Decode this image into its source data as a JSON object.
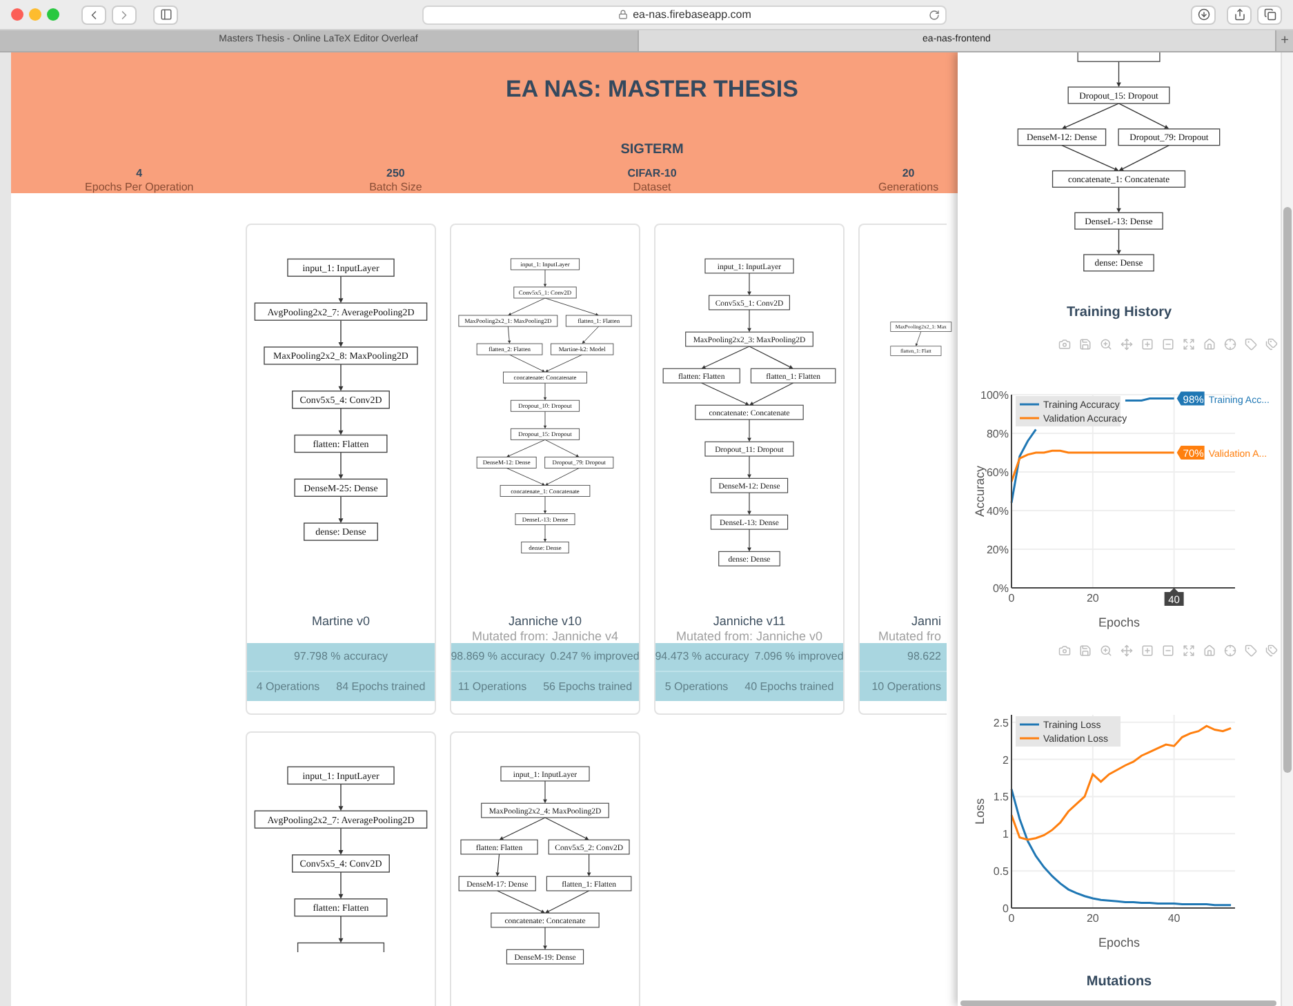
{
  "browser": {
    "url": "ea-nas.firebaseapp.com",
    "tabs": [
      {
        "label": "Masters Thesis - Online LaTeX Editor Overleaf",
        "selected": false
      },
      {
        "label": "ea-nas-frontend",
        "selected": true
      }
    ],
    "new_tab": "+"
  },
  "header": {
    "title": "EA NAS: MASTER THESIS",
    "status": "SIGTERM",
    "stats": [
      {
        "value": "4",
        "label": "Epochs Per Operation"
      },
      {
        "value": "250",
        "label": "Batch Size"
      },
      {
        "value": "CIFAR-10",
        "label": "Dataset"
      },
      {
        "value": "20",
        "label": "Generations"
      }
    ]
  },
  "card_rows": [
    [
      {
        "kind": "full",
        "graph": {
          "cut_bottom": false,
          "rows": [
            [
              {
                "label": "input_1: InputLayer"
              }
            ],
            [
              {
                "label": "AvgPooling2x2_7: AveragePooling2D"
              }
            ],
            [
              {
                "label": "MaxPooling2x2_8: MaxPooling2D"
              }
            ],
            [
              {
                "label": "Conv5x5_4: Conv2D"
              }
            ],
            [
              {
                "label": "flatten: Flatten"
              }
            ],
            [
              {
                "label": "DenseM-25: Dense"
              }
            ],
            [
              {
                "label": "dense: Dense"
              }
            ]
          ]
        },
        "name": "Martine v0",
        "accuracy": "97.798 % accuracy",
        "operations": "4 Operations",
        "epochs": "84 Epochs trained"
      },
      {
        "kind": "full",
        "graph": {
          "cut_bottom": false,
          "rows": [
            [
              {
                "label": "input_1: InputLayer"
              }
            ],
            [
              {
                "label": "Conv5x5_1: Conv2D"
              }
            ],
            [
              {
                "label": "MaxPooling2x2_1: MaxPooling2D"
              },
              {
                "label": "flatten_1: Flatten"
              }
            ],
            [
              {
                "label": "flatten_2: Flatten",
                "join": false
              },
              {
                "label": "Martine-k2: Model",
                "join": false
              }
            ],
            [
              {
                "label": "concatenate: Concatenate",
                "join": true
              }
            ],
            [
              {
                "label": "Dropout_10: Dropout"
              }
            ],
            [
              {
                "label": "Dropout_15: Dropout"
              }
            ],
            [
              {
                "label": "DenseM-12: Dense"
              },
              {
                "label": "Dropout_79: Dropout"
              }
            ],
            [
              {
                "label": "concatenate_1: Concatenate",
                "join": true
              }
            ],
            [
              {
                "label": "DenseL-13: Dense"
              }
            ],
            [
              {
                "label": "dense: Dense"
              }
            ]
          ]
        },
        "name": "Janniche v10",
        "mutated": "Mutated from: Janniche v4",
        "accuracy": "98.869 % accuracy",
        "improvement": "0.247 % improved",
        "operations": "11 Operations",
        "epochs": "56 Epochs trained"
      },
      {
        "kind": "full",
        "graph": {
          "cut_bottom": false,
          "rows": [
            [
              {
                "label": "input_1: InputLayer"
              }
            ],
            [
              {
                "label": "Conv5x5_1: Conv2D"
              }
            ],
            [
              {
                "label": "MaxPooling2x2_3: MaxPooling2D"
              }
            ],
            [
              {
                "label": "flatten: Flatten"
              },
              {
                "label": "flatten_1: Flatten"
              }
            ],
            [
              {
                "label": "concatenate: Concatenate",
                "join": true
              }
            ],
            [
              {
                "label": "Dropout_11: Dropout"
              }
            ],
            [
              {
                "label": "DenseM-12: Dense"
              }
            ],
            [
              {
                "label": "DenseL-13: Dense"
              }
            ],
            [
              {
                "label": "dense: Dense"
              }
            ]
          ]
        },
        "name": "Janniche v11",
        "mutated": "Mutated from: Janniche v0",
        "accuracy": "94.473 % accuracy",
        "improvement": "7.096 % improved",
        "operations": "5 Operations",
        "epochs": "40 Epochs trained"
      },
      {
        "kind": "partial",
        "graph": {
          "cut_bottom": false,
          "rows": [
            [
              {
                "label": "MaxPooling2x2_1: Max"
              }
            ],
            [
              {
                "label": "flatten_1: Flatt"
              }
            ]
          ]
        },
        "name": "Janni",
        "mutated": "Mutated fro",
        "accuracy": "98.622",
        "operations": "10 Operations"
      }
    ],
    [
      {
        "kind": "full",
        "graph": {
          "cut_bottom": true,
          "rows": [
            [
              {
                "label": "input_1: InputLayer"
              }
            ],
            [
              {
                "label": "AvgPooling2x2_7: AveragePooling2D"
              }
            ],
            [
              {
                "label": "Conv5x5_4: Conv2D"
              }
            ],
            [
              {
                "label": "flatten: Flatten"
              }
            ]
          ]
        }
      },
      {
        "kind": "full",
        "graph": {
          "cut_bottom": false,
          "rows": [
            [
              {
                "label": "input_1: InputLayer"
              }
            ],
            [
              {
                "label": "MaxPooling2x2_4: MaxPooling2D"
              }
            ],
            [
              {
                "label": "flatten: Flatten"
              },
              {
                "label": "Conv5x5_2: Conv2D"
              }
            ],
            [
              {
                "label": "DenseM-17: Dense",
                "join": false
              },
              {
                "label": "flatten_1: Flatten",
                "join": false
              }
            ],
            [
              {
                "label": "concatenate: Concatenate",
                "join": true
              }
            ],
            [
              {
                "label": "DenseM-19: Dense"
              }
            ]
          ]
        }
      }
    ]
  ],
  "panel": {
    "graph": {
      "cut_top": true,
      "rows": [
        [
          {
            "label": "Dropout_15: Dropout"
          }
        ],
        [
          {
            "label": "DenseM-12: Dense"
          },
          {
            "label": "Dropout_79: Dropout"
          }
        ],
        [
          {
            "label": "concatenate_1: Concatenate",
            "join": true
          }
        ],
        [
          {
            "label": "DenseL-13: Dense"
          }
        ],
        [
          {
            "label": "dense: Dense"
          }
        ]
      ]
    },
    "history_title": "Training History",
    "charts": [
      {
        "chart_data": {
          "type": "line",
          "xlabel": "Epochs",
          "ylabel": "Accuracy",
          "grid": true,
          "legend": "upper left",
          "x": [
            0,
            2,
            4,
            6,
            8,
            10,
            12,
            14,
            16,
            18,
            20,
            22,
            24,
            26,
            28,
            30,
            32,
            34,
            36,
            38,
            40
          ],
          "series": [
            {
              "name": "Training Accuracy",
              "color": "#1f77b4",
              "values": [
                44,
                68,
                76,
                82,
                null,
                null,
                null,
                null,
                null,
                null,
                null,
                null,
                null,
                null,
                97,
                97,
                97,
                98,
                98,
                98,
                98
              ]
            },
            {
              "name": "Validation Accuracy",
              "color": "#ff7f0e",
              "values": [
                55,
                67,
                69,
                70,
                70,
                71,
                71,
                70,
                70,
                70,
                70,
                70,
                70,
                70,
                70,
                70,
                70,
                70,
                70,
                70,
                70
              ]
            }
          ],
          "xlim": [
            0,
            55
          ],
          "ylim": [
            0,
            100
          ],
          "xticks": [
            0,
            20,
            40
          ],
          "yticks": [
            {
              "value": 0,
              "label": "0%"
            },
            {
              "value": 20,
              "label": "20%"
            },
            {
              "value": 40,
              "label": "40%"
            },
            {
              "value": 60,
              "label": "60%"
            },
            {
              "value": 80,
              "label": "80%"
            },
            {
              "value": 100,
              "label": "100%"
            }
          ],
          "annotations": [
            {
              "x": 40,
              "y": 98,
              "text": "98%"
            },
            "Training Acc...",
            {
              "x": 40,
              "y": 70,
              "text": "70%"
            },
            "Validation A...",
            "40"
          ]
        }
      },
      {
        "chart_data": {
          "type": "line",
          "xlabel": "Epochs",
          "ylabel": "Loss",
          "grid": true,
          "legend": "upper left",
          "x": [
            0,
            2,
            4,
            6,
            8,
            10,
            12,
            14,
            16,
            18,
            20,
            22,
            24,
            26,
            28,
            30,
            32,
            34,
            36,
            38,
            40,
            42,
            44,
            46,
            48,
            50,
            52,
            54
          ],
          "series": [
            {
              "name": "Training Loss",
              "color": "#1f77b4",
              "values": [
                1.6,
                1.2,
                0.9,
                0.7,
                0.55,
                0.43,
                0.33,
                0.25,
                0.2,
                0.16,
                0.13,
                0.11,
                0.1,
                0.09,
                0.08,
                0.08,
                0.07,
                0.07,
                0.06,
                0.06,
                0.06,
                0.05,
                0.05,
                0.05,
                0.05,
                0.04,
                0.04,
                0.04
              ]
            },
            {
              "name": "Validation Loss",
              "color": "#ff7f0e",
              "values": [
                1.25,
                0.95,
                0.92,
                0.94,
                0.98,
                1.05,
                1.15,
                1.3,
                1.4,
                1.5,
                1.8,
                1.7,
                1.8,
                1.86,
                1.92,
                1.97,
                2.05,
                2.1,
                2.15,
                2.2,
                2.18,
                2.3,
                2.35,
                2.38,
                2.45,
                2.4,
                2.38,
                2.42
              ]
            }
          ],
          "xlim": [
            0,
            55
          ],
          "ylim": [
            0,
            2.6
          ],
          "xticks": [
            0,
            20,
            40
          ],
          "yticks": [
            {
              "value": 0,
              "label": "0"
            },
            {
              "value": 0.5,
              "label": "0.5"
            },
            {
              "value": 1,
              "label": "1"
            },
            {
              "value": 1.5,
              "label": "1.5"
            },
            {
              "value": 2,
              "label": "2"
            },
            {
              "value": 2.5,
              "label": "2.5"
            }
          ]
        }
      }
    ],
    "mutations_title": "Mutations"
  }
}
